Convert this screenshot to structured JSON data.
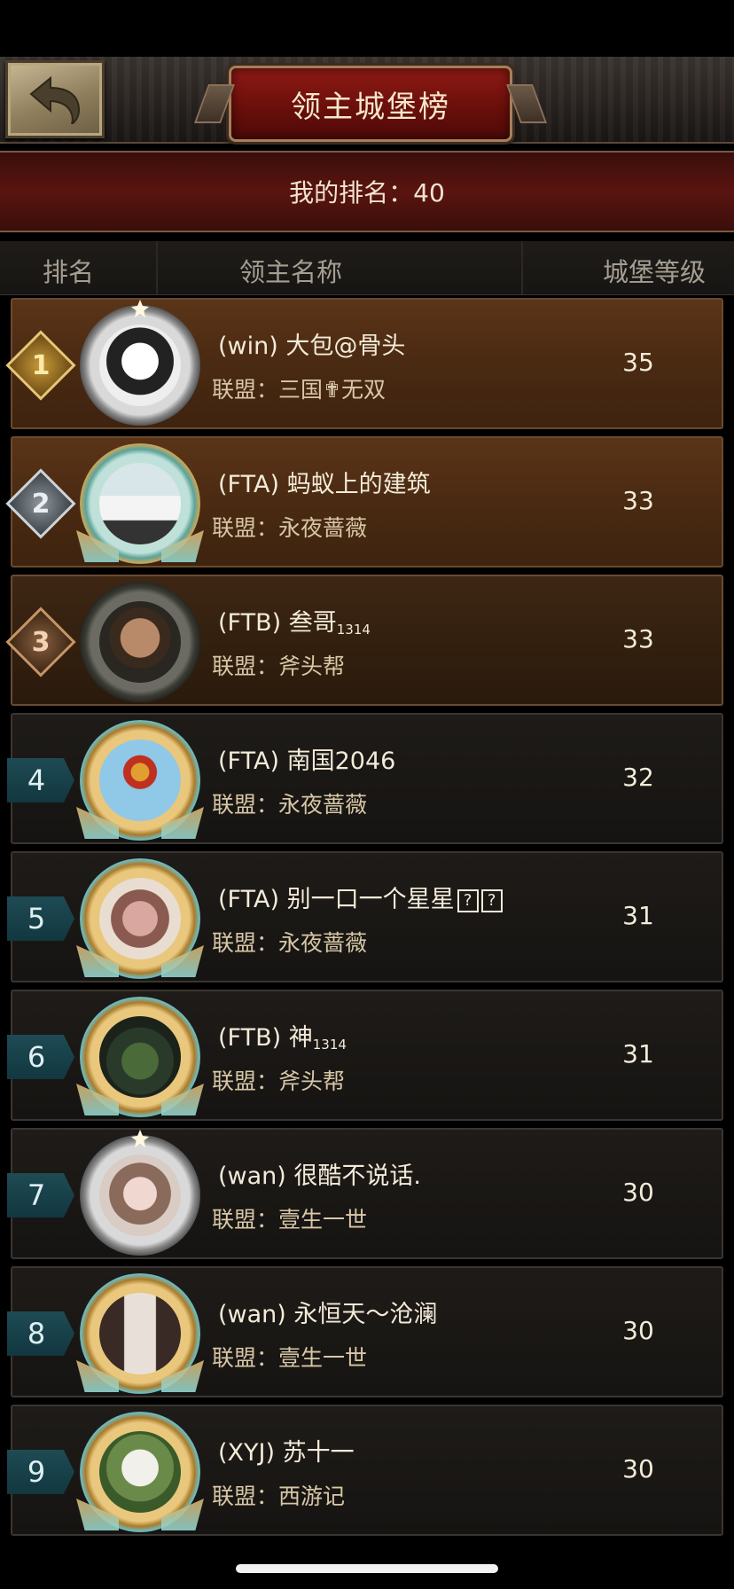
{
  "header": {
    "title": "领主城堡榜",
    "my_rank_label": "我的排名：40"
  },
  "columns": {
    "rank": "排名",
    "name": "领主名称",
    "level": "城堡等级"
  },
  "rows": [
    {
      "rank": "1",
      "guild": "(win)",
      "name": "大包@骨头",
      "suffix": "",
      "alliance": "联盟：三国✟无双",
      "level": "35",
      "avatar": "hooded-figure-avatar"
    },
    {
      "rank": "2",
      "guild": "(FTA)",
      "name": "蚂蚁上的建筑",
      "suffix": "",
      "alliance": "联盟：永夜蔷薇",
      "level": "33",
      "avatar": "white-car-avatar"
    },
    {
      "rank": "3",
      "guild": "(FTB)",
      "name": "叁哥",
      "suffix": "1314",
      "alliance": "联盟：斧头帮",
      "level": "33",
      "avatar": "man-portrait-avatar"
    },
    {
      "rank": "4",
      "guild": "(FTA)",
      "name": "南国2046",
      "suffix": "",
      "alliance": "联盟：永夜蔷薇",
      "level": "32",
      "avatar": "hot-air-balloon-avatar"
    },
    {
      "rank": "5",
      "guild": "(FTA)",
      "name": "别一口一个星星",
      "suffix": "",
      "alliance": "联盟：永夜蔷薇",
      "level": "31",
      "avatar": "creature-avatar"
    },
    {
      "rank": "6",
      "guild": "(FTB)",
      "name": "神",
      "suffix": "1314",
      "alliance": "联盟：斧头帮",
      "level": "31",
      "avatar": "game-map-avatar"
    },
    {
      "rank": "7",
      "guild": "(wan)",
      "name": "很酷不说话.",
      "suffix": "",
      "alliance": "联盟：壹生一世",
      "level": "30",
      "avatar": "girl-portrait-avatar"
    },
    {
      "rank": "8",
      "guild": "(wan)",
      "name": "永恒天～沧澜",
      "suffix": "",
      "alliance": "联盟：壹生一世",
      "level": "30",
      "avatar": "couple-photo-avatar"
    },
    {
      "rank": "9",
      "guild": "(XYJ)",
      "name": "苏十一",
      "suffix": "",
      "alliance": "联盟：西游记",
      "level": "30",
      "avatar": "alpaca-avatar"
    }
  ],
  "colors": {
    "title_plate": "#6b0f0b",
    "top_row_bg": "#4a2a12",
    "rank_tag": "#1e4b54",
    "text": "#f3ebd9",
    "alliance_text": "#d8c7a6"
  }
}
